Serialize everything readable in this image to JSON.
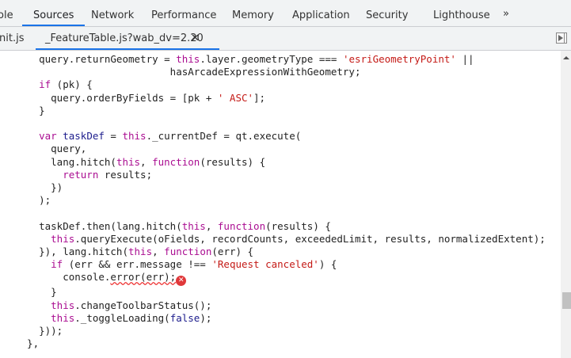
{
  "tabs": [
    {
      "label": "ole",
      "left": "-3"
    },
    {
      "label": "Sources"
    },
    {
      "label": "Network"
    },
    {
      "label": "Performance"
    },
    {
      "label": "Memory"
    },
    {
      "label": "Application"
    },
    {
      "label": "Security"
    },
    {
      "label": "Lighthouse"
    }
  ],
  "more_tabs": "»",
  "files": [
    {
      "label": "nit.js"
    },
    {
      "label": "_FeatureTable.js?wab_dv=2.20"
    }
  ],
  "close_label": "✕",
  "error_icon": "✕",
  "code": [
    [
      [
        "p",
        "    query.returnGeometry = "
      ],
      [
        "kw",
        "this"
      ],
      [
        "p",
        ".layer.geometryType === "
      ],
      [
        "str",
        "'esriGeometryPoint'"
      ],
      [
        "p",
        " ||"
      ]
    ],
    [
      [
        "p",
        "                          hasArcadeExpressionWithGeometry;"
      ]
    ],
    [
      [
        "kw",
        "    if"
      ],
      [
        "p",
        " (pk) {"
      ]
    ],
    [
      [
        "p",
        "      query.orderByFields = [pk + "
      ],
      [
        "str",
        "' ASC'"
      ],
      [
        "p",
        "];"
      ]
    ],
    [
      [
        "p",
        "    }"
      ]
    ],
    [
      [
        "p",
        ""
      ]
    ],
    [
      [
        "kw",
        "    var"
      ],
      [
        "var",
        " taskDef"
      ],
      [
        "p",
        " = "
      ],
      [
        "kw",
        "this"
      ],
      [
        "p",
        "._currentDef = qt.execute("
      ]
    ],
    [
      [
        "p",
        "      query,"
      ]
    ],
    [
      [
        "p",
        "      lang.hitch("
      ],
      [
        "kw",
        "this"
      ],
      [
        "p",
        ", "
      ],
      [
        "kw",
        "function"
      ],
      [
        "p",
        "(results) {"
      ]
    ],
    [
      [
        "kw",
        "        return"
      ],
      [
        "p",
        " results;"
      ]
    ],
    [
      [
        "p",
        "      })"
      ]
    ],
    [
      [
        "p",
        "    );"
      ]
    ],
    [
      [
        "p",
        ""
      ]
    ],
    [
      [
        "p",
        "    taskDef.then(lang.hitch("
      ],
      [
        "kw",
        "this"
      ],
      [
        "p",
        ", "
      ],
      [
        "kw",
        "function"
      ],
      [
        "p",
        "(results) {"
      ]
    ],
    [
      [
        "kw",
        "      this"
      ],
      [
        "p",
        ".queryExecute(oFields, recordCounts, exceededLimit, results, normalizedExtent);"
      ]
    ],
    [
      [
        "p",
        "    }), lang.hitch("
      ],
      [
        "kw",
        "this"
      ],
      [
        "p",
        ", "
      ],
      [
        "kw",
        "function"
      ],
      [
        "p",
        "(err) {"
      ]
    ],
    [
      [
        "kw",
        "      if"
      ],
      [
        "p",
        " (err && err.message !== "
      ],
      [
        "str",
        "'Request canceled'"
      ],
      [
        "p",
        ") {"
      ]
    ],
    [
      [
        "p",
        "        console."
      ],
      [
        "err",
        "error(err);"
      ],
      [
        "icon",
        ""
      ]
    ],
    [
      [
        "p",
        "      }"
      ]
    ],
    [
      [
        "kw",
        "      this"
      ],
      [
        "p",
        ".changeToolbarStatus();"
      ]
    ],
    [
      [
        "kw",
        "      this"
      ],
      [
        "p",
        "._toggleLoading("
      ],
      [
        "var",
        "false"
      ],
      [
        "p",
        ");"
      ]
    ],
    [
      [
        "p",
        "    }));"
      ]
    ],
    [
      [
        "p",
        "  },"
      ]
    ]
  ]
}
